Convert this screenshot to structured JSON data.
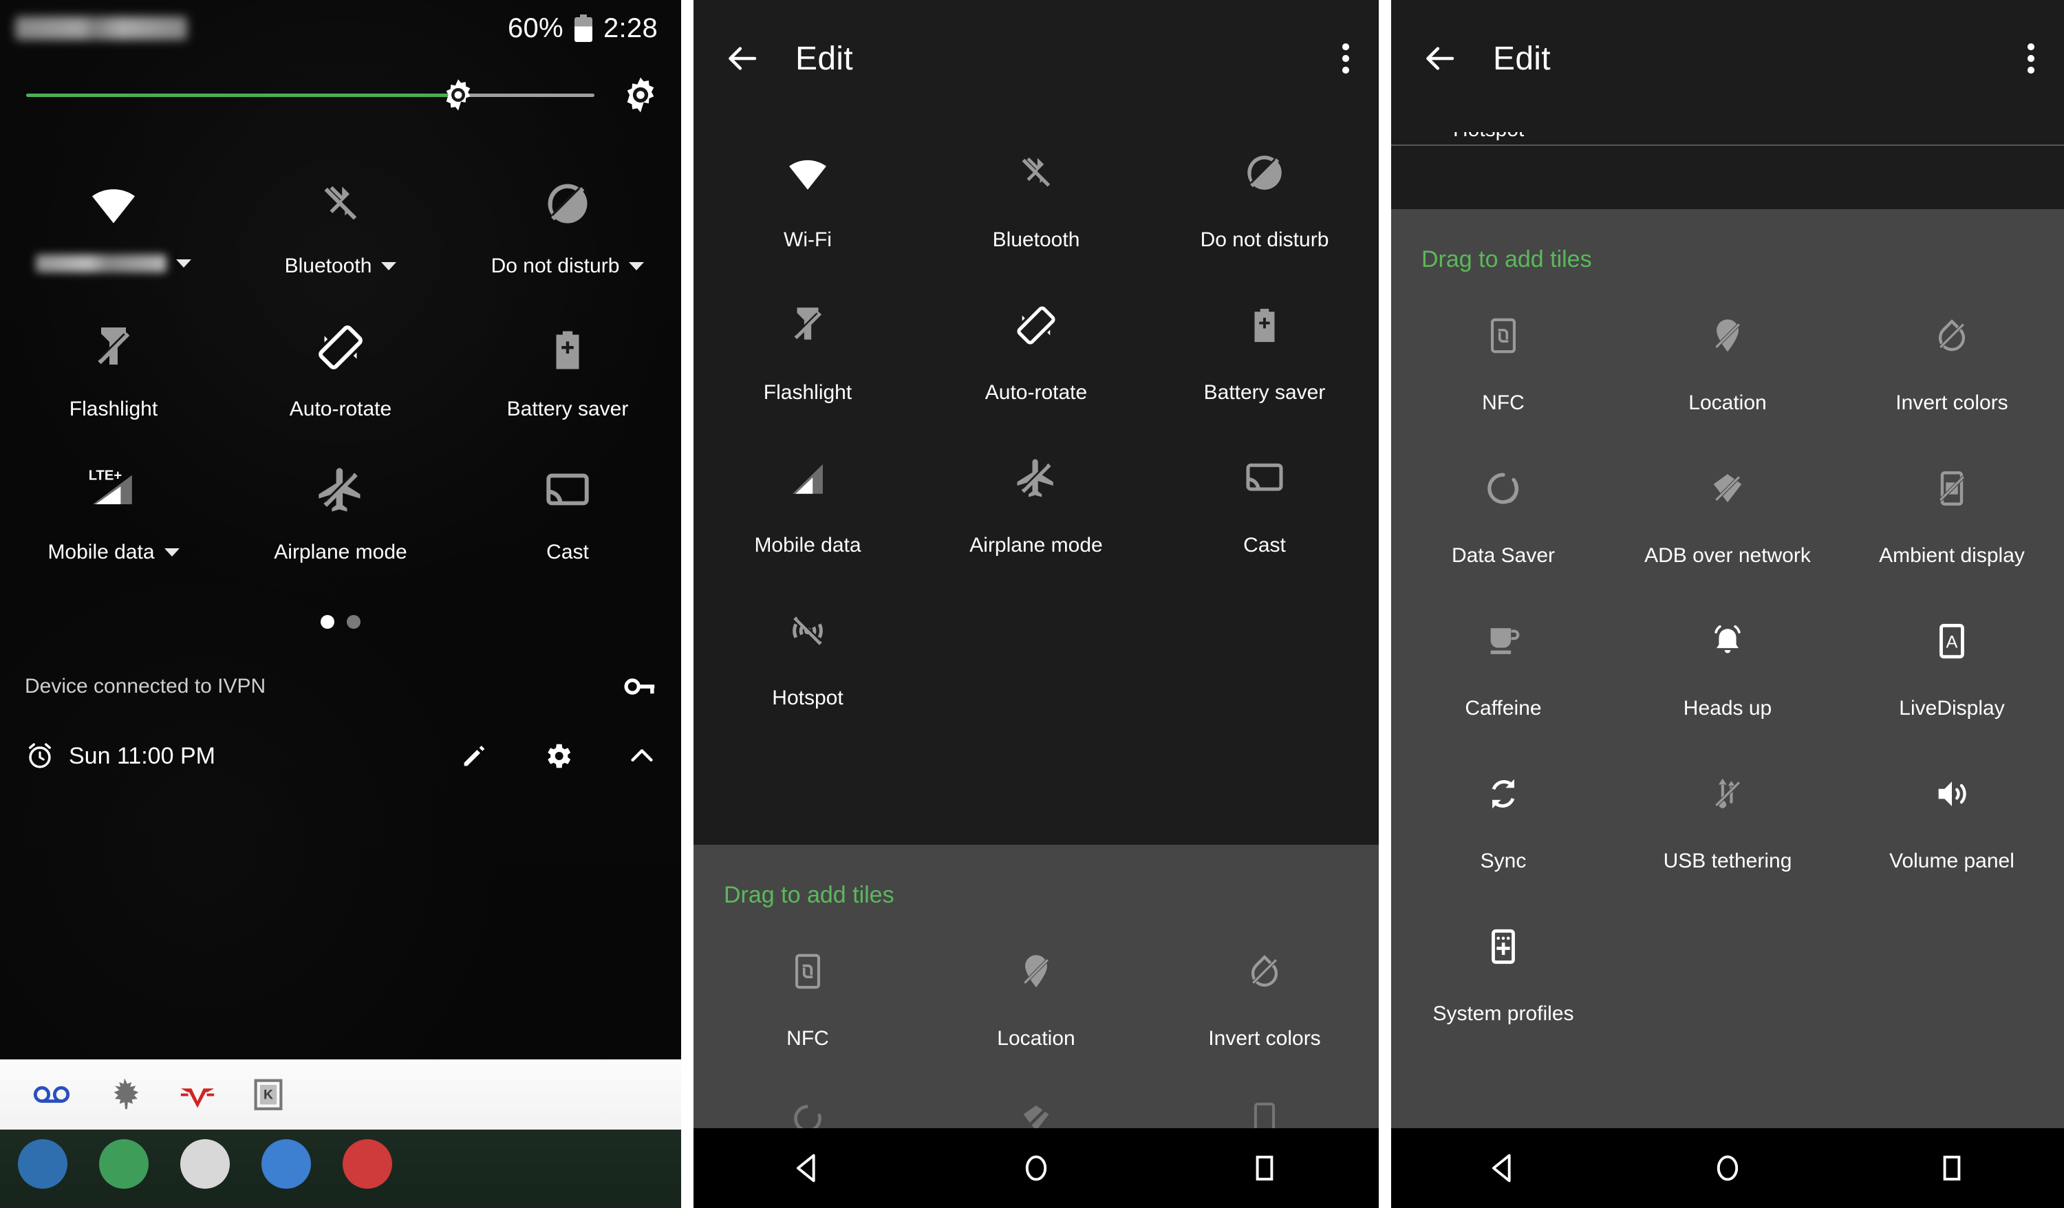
{
  "quick_settings": {
    "status_bar": {
      "carrier": "",
      "battery_percent": "60%",
      "clock": "2:28"
    },
    "brightness": {
      "value_percent": 76
    },
    "tiles": [
      {
        "label": "",
        "icon": "wifi-icon",
        "state": "on",
        "has_caret": true,
        "blurred_label": true
      },
      {
        "label": "Bluetooth",
        "icon": "bluetooth-disabled-icon",
        "state": "off",
        "has_caret": true
      },
      {
        "label": "Do not disturb",
        "icon": "do-not-disturb-icon",
        "state": "off",
        "has_caret": true
      },
      {
        "label": "Flashlight",
        "icon": "flashlight-off-icon",
        "state": "off",
        "has_caret": false
      },
      {
        "label": "Auto-rotate",
        "icon": "auto-rotate-icon",
        "state": "on",
        "has_caret": false
      },
      {
        "label": "Battery saver",
        "icon": "battery-saver-icon",
        "state": "off",
        "has_caret": false
      },
      {
        "label": "Mobile data",
        "icon": "lte-signal-icon",
        "state": "on",
        "has_caret": true,
        "badge": "LTE+"
      },
      {
        "label": "Airplane mode",
        "icon": "airplane-off-icon",
        "state": "off",
        "has_caret": false
      },
      {
        "label": "Cast",
        "icon": "cast-icon",
        "state": "off",
        "has_caret": false
      }
    ],
    "page_dots": {
      "count": 2,
      "active_index": 0
    },
    "vpn_notice": {
      "text": "Device connected to IVPN",
      "icon": "key-icon"
    },
    "footer": {
      "alarm_icon": "alarm-icon",
      "alarm_text": "Sun 11:00 PM",
      "edit_icon": "pencil-icon",
      "settings_icon": "gear-icon",
      "collapse_icon": "chevron-up-icon"
    },
    "notification_shade_icons": [
      "voicemail-icon",
      "maple-leaf-icon",
      "red-v-icon",
      "k-badge-icon"
    ]
  },
  "edit_panel_mid": {
    "header": {
      "back_icon": "back-arrow-icon",
      "title": "Edit",
      "overflow_icon": "overflow-menu-icon"
    },
    "active_tiles": [
      {
        "label": "Wi-Fi",
        "icon": "wifi-icon",
        "state": "on"
      },
      {
        "label": "Bluetooth",
        "icon": "bluetooth-disabled-icon",
        "state": "off"
      },
      {
        "label": "Do not disturb",
        "icon": "do-not-disturb-icon",
        "state": "off"
      },
      {
        "label": "Flashlight",
        "icon": "flashlight-off-icon",
        "state": "off"
      },
      {
        "label": "Auto-rotate",
        "icon": "auto-rotate-icon",
        "state": "on"
      },
      {
        "label": "Battery saver",
        "icon": "battery-saver-icon",
        "state": "off"
      },
      {
        "label": "Mobile data",
        "icon": "signal-icon",
        "state": "on"
      },
      {
        "label": "Airplane mode",
        "icon": "airplane-off-icon",
        "state": "off"
      },
      {
        "label": "Cast",
        "icon": "cast-icon",
        "state": "off"
      },
      {
        "label": "Hotspot",
        "icon": "hotspot-off-icon",
        "state": "off"
      }
    ],
    "drag_header": "Drag to add tiles",
    "available_tiles": [
      {
        "label": "NFC",
        "icon": "nfc-icon"
      },
      {
        "label": "Location",
        "icon": "location-off-icon"
      },
      {
        "label": "Invert colors",
        "icon": "invert-colors-off-icon"
      }
    ]
  },
  "edit_panel_right": {
    "header": {
      "back_icon": "back-arrow-icon",
      "title": "Edit",
      "overflow_icon": "overflow-menu-icon"
    },
    "clipped_tile_label": "Hotspot",
    "drag_header": "Drag to add tiles",
    "available_tiles": [
      {
        "label": "NFC",
        "icon": "nfc-icon"
      },
      {
        "label": "Location",
        "icon": "location-off-icon"
      },
      {
        "label": "Invert colors",
        "icon": "invert-colors-off-icon"
      },
      {
        "label": "Data Saver",
        "icon": "data-saver-icon"
      },
      {
        "label": "ADB over network",
        "icon": "adb-over-network-icon"
      },
      {
        "label": "Ambient display",
        "icon": "ambient-display-off-icon"
      },
      {
        "label": "Caffeine",
        "icon": "caffeine-icon"
      },
      {
        "label": "Heads up",
        "icon": "heads-up-icon"
      },
      {
        "label": "LiveDisplay",
        "icon": "livedisplay-icon"
      },
      {
        "label": "Sync",
        "icon": "sync-icon"
      },
      {
        "label": "USB tethering",
        "icon": "usb-tethering-off-icon"
      },
      {
        "label": "Volume panel",
        "icon": "volume-panel-icon"
      },
      {
        "label": "System profiles",
        "icon": "system-profiles-icon"
      }
    ]
  },
  "navigation_bar": {
    "back": "back-triangle-icon",
    "home": "home-circle-icon",
    "recents": "recents-square-icon"
  },
  "colors": {
    "accent_green": "#4caf50",
    "drag_header_green": "#5cb85c",
    "panel_dark": "#1c1c1c",
    "panel_gray": "#464646",
    "icon_on": "#ffffff",
    "icon_off": "#9a9a9a"
  }
}
